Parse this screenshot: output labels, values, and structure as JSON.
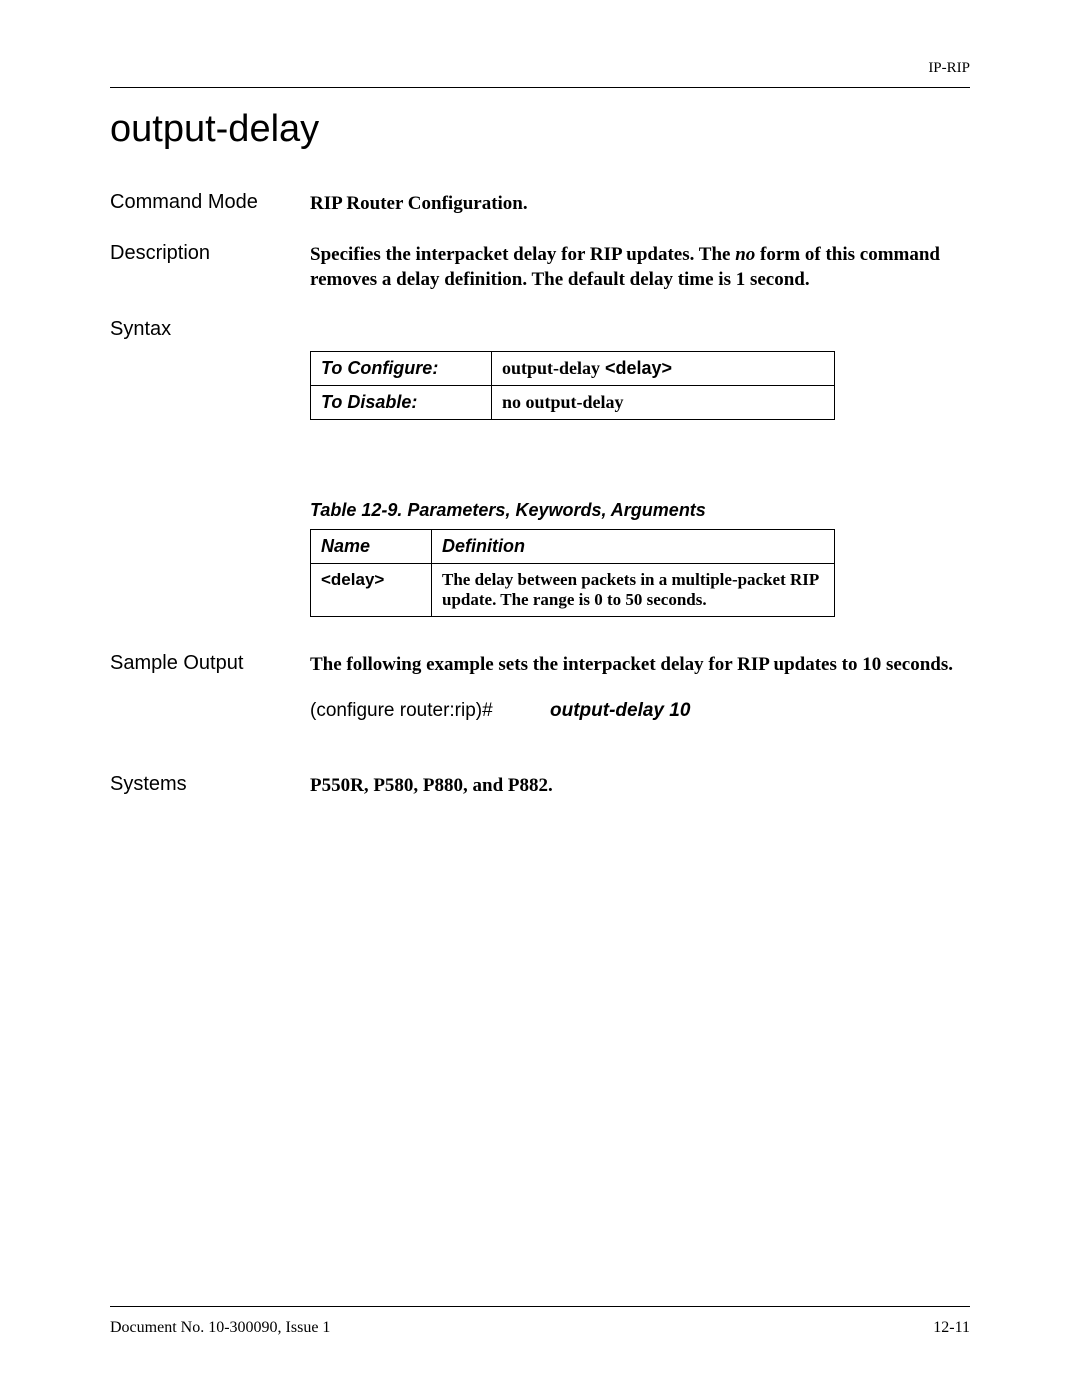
{
  "header": {
    "right": "IP-RIP"
  },
  "title": "output-delay",
  "command_mode": {
    "label": "Command Mode",
    "value": "RIP Router Configuration."
  },
  "description": {
    "label": "Description",
    "value_pre": "Specifies the interpacket delay for RIP updates. The ",
    "value_no": "no",
    "value_post": " form of this command removes a delay definition. The default delay time is 1 second."
  },
  "syntax": {
    "label": "Syntax",
    "rows": [
      {
        "label": "To Configure:",
        "cmd_prefix": "output-delay",
        "cmd_bold": " <delay>"
      },
      {
        "label": "To Disable:",
        "cmd_plain": "no output-delay"
      }
    ]
  },
  "params_table": {
    "caption": "Table 12-9. Parameters, Keywords, Arguments",
    "head": {
      "name": "Name",
      "def": "Definition"
    },
    "rows": [
      {
        "name": "<delay>",
        "def": "The delay between packets in a multiple-packet RIP update. The range is 0 to 50 seconds."
      }
    ]
  },
  "sample_output": {
    "label": "Sample Output",
    "text": "The following example sets the interpacket delay for RIP updates to 10 seconds.",
    "prompt": "(configure router:rip)#",
    "command": "output-delay 10"
  },
  "systems": {
    "label": "Systems",
    "value": "P550R, P580, P880, and P882."
  },
  "footer": {
    "left": "Document No. 10-300090, Issue 1",
    "right": "12-11"
  }
}
